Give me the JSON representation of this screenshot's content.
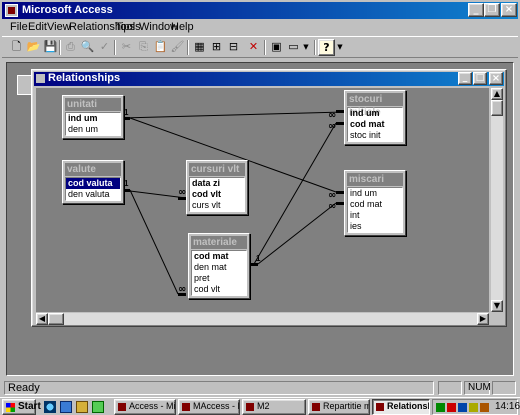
{
  "app": {
    "title": "Microsoft Access",
    "controls": {
      "minimize": "_",
      "restore": "❐",
      "close": "×"
    }
  },
  "menu": [
    "File",
    "Edit",
    "View",
    "Relationships",
    "Tools",
    "Window",
    "Help"
  ],
  "toolbar": {
    "buttons": [
      {
        "icon": "new-icon",
        "glyph": "🗋",
        "enabled": true
      },
      {
        "icon": "open-icon",
        "glyph": "📂",
        "enabled": true
      },
      {
        "icon": "save-icon",
        "glyph": "💾",
        "enabled": true
      },
      {
        "icon": "print-icon",
        "glyph": "⎙",
        "enabled": false
      },
      {
        "icon": "print-preview-icon",
        "glyph": "🔍",
        "enabled": false
      },
      {
        "icon": "spelling-icon",
        "glyph": "✓",
        "enabled": false
      },
      {
        "icon": "cut-icon",
        "glyph": "✂",
        "enabled": false
      },
      {
        "icon": "copy-icon",
        "glyph": "⎘",
        "enabled": false
      },
      {
        "icon": "paste-icon",
        "glyph": "📋",
        "enabled": false
      },
      {
        "icon": "format-painter-icon",
        "glyph": "🖌",
        "enabled": false
      },
      {
        "icon": "show-table-icon",
        "glyph": "▦",
        "enabled": true
      },
      {
        "icon": "show-direct-icon",
        "glyph": "⊞",
        "enabled": true
      },
      {
        "icon": "show-all-icon",
        "glyph": "⊟",
        "enabled": true
      },
      {
        "icon": "delete-icon",
        "glyph": "✕",
        "enabled": true
      },
      {
        "icon": "database-window-icon",
        "glyph": "▣",
        "enabled": true
      },
      {
        "icon": "new-object-icon",
        "glyph": "▭",
        "enabled": true
      },
      {
        "icon": "office-assistant-icon",
        "glyph": "?",
        "enabled": true
      }
    ]
  },
  "relationships_window": {
    "title": "Relationships",
    "tables": [
      {
        "name": "unitati",
        "fields": [
          {
            "name": "ind um",
            "pk": true
          },
          {
            "name": "den um",
            "pk": false
          }
        ]
      },
      {
        "name": "valute",
        "fields": [
          {
            "name": "cod valuta",
            "pk": true,
            "selected": true
          },
          {
            "name": "den valuta",
            "pk": false
          }
        ]
      },
      {
        "name": "cursuri vlt",
        "fields": [
          {
            "name": "data zi",
            "pk": true
          },
          {
            "name": "cod vlt",
            "pk": true
          },
          {
            "name": "curs vlt",
            "pk": false
          }
        ]
      },
      {
        "name": "materiale",
        "fields": [
          {
            "name": "cod mat",
            "pk": true
          },
          {
            "name": "den mat",
            "pk": false
          },
          {
            "name": "pret",
            "pk": false
          },
          {
            "name": "cod vlt",
            "pk": false
          }
        ]
      },
      {
        "name": "stocuri initiale",
        "fields": [
          {
            "name": "ind um",
            "pk": true
          },
          {
            "name": "cod mat",
            "pk": true
          },
          {
            "name": "stoc init",
            "pk": false
          }
        ]
      },
      {
        "name": "miscari",
        "fields": [
          {
            "name": "ind um",
            "pk": false
          },
          {
            "name": "cod mat",
            "pk": false
          },
          {
            "name": "int",
            "pk": false
          },
          {
            "name": "ies",
            "pk": false
          }
        ]
      }
    ],
    "relationships": [
      {
        "from": "unitati.ind um",
        "to": "stocuri initiale.ind um",
        "one": "1",
        "many": "∞"
      },
      {
        "from": "unitati.ind um",
        "to": "miscari.ind um",
        "one": "1",
        "many": "∞"
      },
      {
        "from": "valute.cod valuta",
        "to": "cursuri vlt.cod vlt",
        "one": "1",
        "many": "∞"
      },
      {
        "from": "valute.cod valuta",
        "to": "materiale.cod vlt",
        "one": "1",
        "many": "∞"
      },
      {
        "from": "materiale.cod mat",
        "to": "stocuri initiale.cod mat",
        "one": "1",
        "many": "∞"
      },
      {
        "from": "materiale.cod mat",
        "to": "miscari.cod mat",
        "one": "1",
        "many": "∞"
      }
    ]
  },
  "status": {
    "text": "Ready",
    "num": "NUM"
  },
  "taskbar": {
    "start": "Start",
    "tasks": [
      {
        "label": "Access - Mic...",
        "active": false
      },
      {
        "label": "MAccess - M...",
        "active": false
      },
      {
        "label": "M2",
        "active": false
      },
      {
        "label": "Repartitie ma...",
        "active": false
      },
      {
        "label": "Relationsh...",
        "active": true
      }
    ],
    "clock": "14:16"
  }
}
